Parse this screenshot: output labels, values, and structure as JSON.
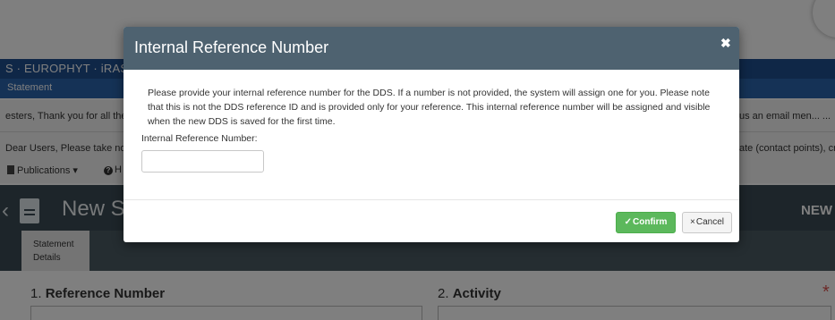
{
  "background": {
    "nav_text": "S · EUROPHYT · iRAS",
    "statement_bar": "Statement",
    "message1_left": "esters, Thank you for all the",
    "message1_right": "us an email men...  ...",
    "message2_left": "Dear Users, Please take no",
    "message2_right": "ate (contact points), cr",
    "menu": {
      "publications_label": "Publications ▾",
      "help_label": "H"
    },
    "header_title": "New St",
    "header_right": "NEW",
    "tab": {
      "line1": "Statement",
      "line2": "Details"
    },
    "section1": {
      "number": "1.",
      "label": "Reference Number"
    },
    "section2": {
      "number": "2.",
      "label": "Activity"
    },
    "required_mark": "*"
  },
  "modal": {
    "title": "Internal Reference Number",
    "close_glyph": "✖",
    "description": "Please provide your internal reference number for the DDS. If a number is not provided, the system will assign one for you. Please note that this is not the DDS reference ID and is provided only for your reference. This internal reference number will be assigned and visible when the new DDS is saved for the first time.",
    "field_label": "Internal Reference Number:",
    "field_value": "",
    "confirm": {
      "icon": "✓",
      "label": "Confirm"
    },
    "cancel": {
      "icon": "×",
      "label": "Cancel"
    }
  },
  "colors": {
    "modal_header": "#4e6270",
    "confirm_green": "#5cb85c",
    "nav_blue": "#1f4f8f",
    "required_red": "#d9534f"
  }
}
